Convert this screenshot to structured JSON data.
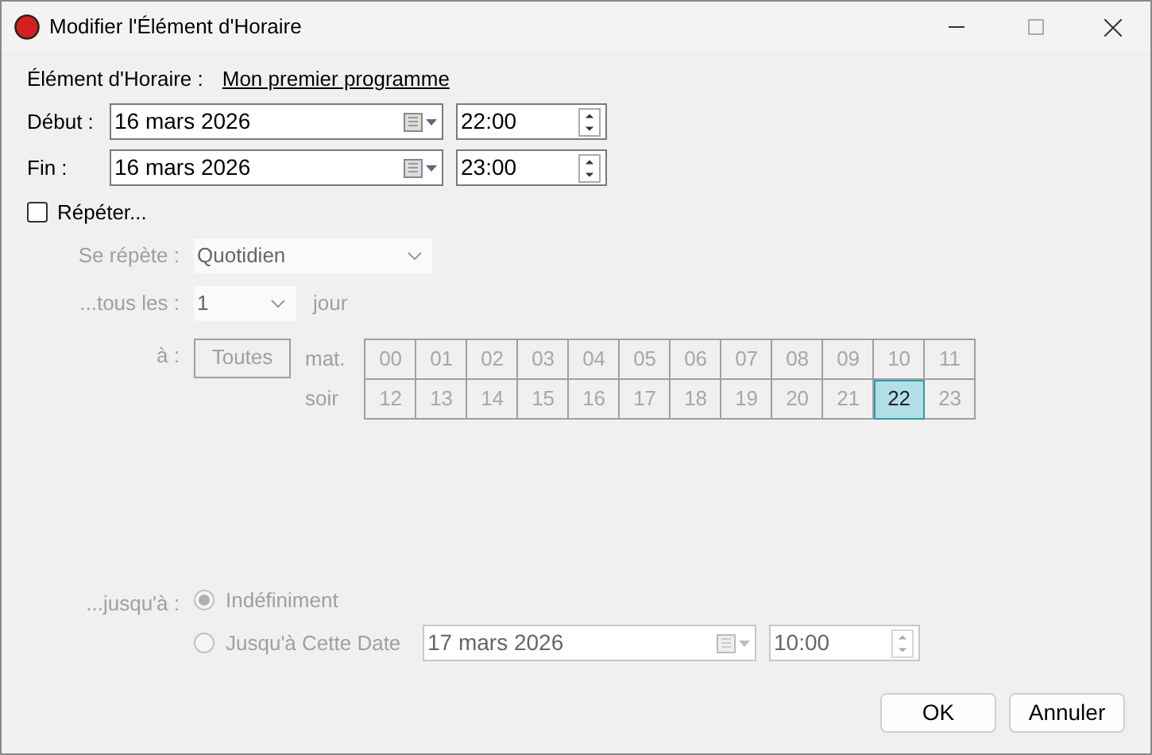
{
  "window": {
    "title": "Modifier l'Élément d'Horaire"
  },
  "item": {
    "label": "Élément d'Horaire :",
    "link": "Mon premier programme"
  },
  "start": {
    "label": "Début :",
    "date": "16 mars 2026",
    "time": "22:00"
  },
  "end": {
    "label": "Fin :",
    "date": "16 mars 2026",
    "time": "23:00"
  },
  "repeat": {
    "label": "Répéter...",
    "checked": false,
    "frequency_label": "Se répète :",
    "frequency": "Quotidien",
    "interval_label": "...tous les :",
    "interval": "1",
    "interval_unit": "jour",
    "at_label": "à :",
    "all_button": "Toutes",
    "morning_label": "mat.",
    "evening_label": "soir",
    "hours": [
      {
        "label": "00",
        "selected": false
      },
      {
        "label": "01",
        "selected": false
      },
      {
        "label": "02",
        "selected": false
      },
      {
        "label": "03",
        "selected": false
      },
      {
        "label": "04",
        "selected": false
      },
      {
        "label": "05",
        "selected": false
      },
      {
        "label": "06",
        "selected": false
      },
      {
        "label": "07",
        "selected": false
      },
      {
        "label": "08",
        "selected": false
      },
      {
        "label": "09",
        "selected": false
      },
      {
        "label": "10",
        "selected": false
      },
      {
        "label": "11",
        "selected": false
      },
      {
        "label": "12",
        "selected": false
      },
      {
        "label": "13",
        "selected": false
      },
      {
        "label": "14",
        "selected": false
      },
      {
        "label": "15",
        "selected": false
      },
      {
        "label": "16",
        "selected": false
      },
      {
        "label": "17",
        "selected": false
      },
      {
        "label": "18",
        "selected": false
      },
      {
        "label": "19",
        "selected": false
      },
      {
        "label": "20",
        "selected": false
      },
      {
        "label": "21",
        "selected": false
      },
      {
        "label": "22",
        "selected": true
      },
      {
        "label": "23",
        "selected": false
      }
    ],
    "until_label": "...jusqu'à :",
    "until_options": [
      {
        "label": "Indéfiniment",
        "selected": true
      },
      {
        "label": "Jusqu'à Cette Date",
        "selected": false
      }
    ],
    "until_date": "17 mars 2026",
    "until_time": "10:00"
  },
  "buttons": [
    "OK",
    "Annuler"
  ]
}
